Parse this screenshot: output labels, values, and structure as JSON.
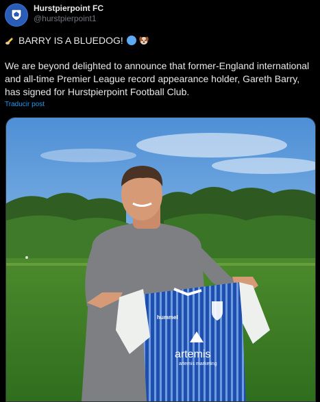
{
  "header": {
    "display_name": "Hurstpierpoint FC",
    "handle": "@hurstpierpoint1",
    "avatar_icon": "club-crest-icon",
    "avatar_color": "#2a5db8"
  },
  "tweet": {
    "headline": "BARRY IS A BLUEDOG!",
    "headline_icons": [
      "writing-hand-icon",
      "blue-circle-icon",
      "dog-face-icon"
    ],
    "body": "We are beyond delighted to announce that former-England international and all-time Premier League record appearance holder, Gareth Barry, has signed for Hurstpierpoint Football Club.",
    "translate_link": "Traducir post"
  },
  "media": {
    "shirt_brand": "hummel",
    "sponsor_name": "artemis",
    "sponsor_tagline": "artemis marketing",
    "shirt_color": "#1f4fae"
  }
}
